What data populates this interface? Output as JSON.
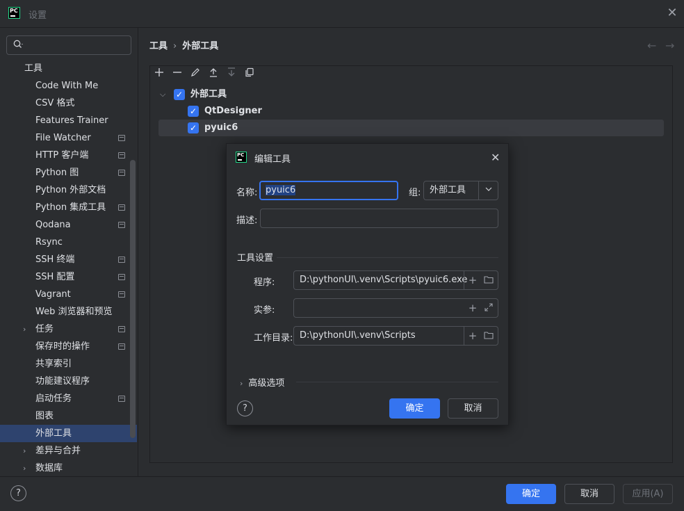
{
  "window": {
    "title": "设置"
  },
  "search": {
    "placeholder": ""
  },
  "sidebar": {
    "root_label": "工具",
    "items": [
      {
        "label": "Code With Me",
        "doc": false,
        "arrow": false
      },
      {
        "label": "CSV 格式",
        "doc": false,
        "arrow": false
      },
      {
        "label": "Features Trainer",
        "doc": false,
        "arrow": false
      },
      {
        "label": "File Watcher",
        "doc": true,
        "arrow": false
      },
      {
        "label": "HTTP 客户端",
        "doc": true,
        "arrow": false
      },
      {
        "label": "Python 图",
        "doc": true,
        "arrow": false
      },
      {
        "label": "Python 外部文档",
        "doc": false,
        "arrow": false
      },
      {
        "label": "Python 集成工具",
        "doc": true,
        "arrow": false
      },
      {
        "label": "Qodana",
        "doc": true,
        "arrow": false
      },
      {
        "label": "Rsync",
        "doc": false,
        "arrow": false
      },
      {
        "label": "SSH 终端",
        "doc": true,
        "arrow": false
      },
      {
        "label": "SSH 配置",
        "doc": true,
        "arrow": false
      },
      {
        "label": "Vagrant",
        "doc": true,
        "arrow": false
      },
      {
        "label": "Web 浏览器和预览",
        "doc": false,
        "arrow": false
      },
      {
        "label": "任务",
        "doc": true,
        "arrow": true
      },
      {
        "label": "保存时的操作",
        "doc": true,
        "arrow": false
      },
      {
        "label": "共享索引",
        "doc": false,
        "arrow": false
      },
      {
        "label": "功能建议程序",
        "doc": false,
        "arrow": false
      },
      {
        "label": "启动任务",
        "doc": true,
        "arrow": false
      },
      {
        "label": "图表",
        "doc": false,
        "arrow": false
      },
      {
        "label": "外部工具",
        "doc": false,
        "arrow": false,
        "selected": true
      },
      {
        "label": "差异与合并",
        "doc": false,
        "arrow": true
      },
      {
        "label": "数据库",
        "doc": false,
        "arrow": true
      }
    ]
  },
  "breadcrumb": {
    "part1": "工具",
    "sep": "›",
    "part2": "外部工具"
  },
  "tools_tree": {
    "group_label": "外部工具",
    "children": [
      "QtDesigner",
      "pyuic6"
    ]
  },
  "dialog": {
    "title": "编辑工具",
    "name_label": "名称:",
    "name_value": "pyuic6",
    "group_label": "组:",
    "group_value": "外部工具",
    "desc_label": "描述:",
    "desc_value": "",
    "section_tool_settings": "工具设置",
    "program_label": "程序:",
    "program_value": "D:\\pythonUI\\.venv\\Scripts\\pyuic6.exe",
    "args_label": "实参:",
    "args_value": "",
    "workdir_label": "工作目录:",
    "workdir_value": "D:\\pythonUI\\.venv\\Scripts",
    "advanced_label": "高级选项",
    "ok_label": "确定",
    "cancel_label": "取消"
  },
  "footer": {
    "ok_label": "确定",
    "cancel_label": "取消",
    "apply_label": "应用(A)"
  },
  "colors": {
    "accent": "#3574f0",
    "selection": "#2e436e",
    "background": "#2b2d30"
  }
}
